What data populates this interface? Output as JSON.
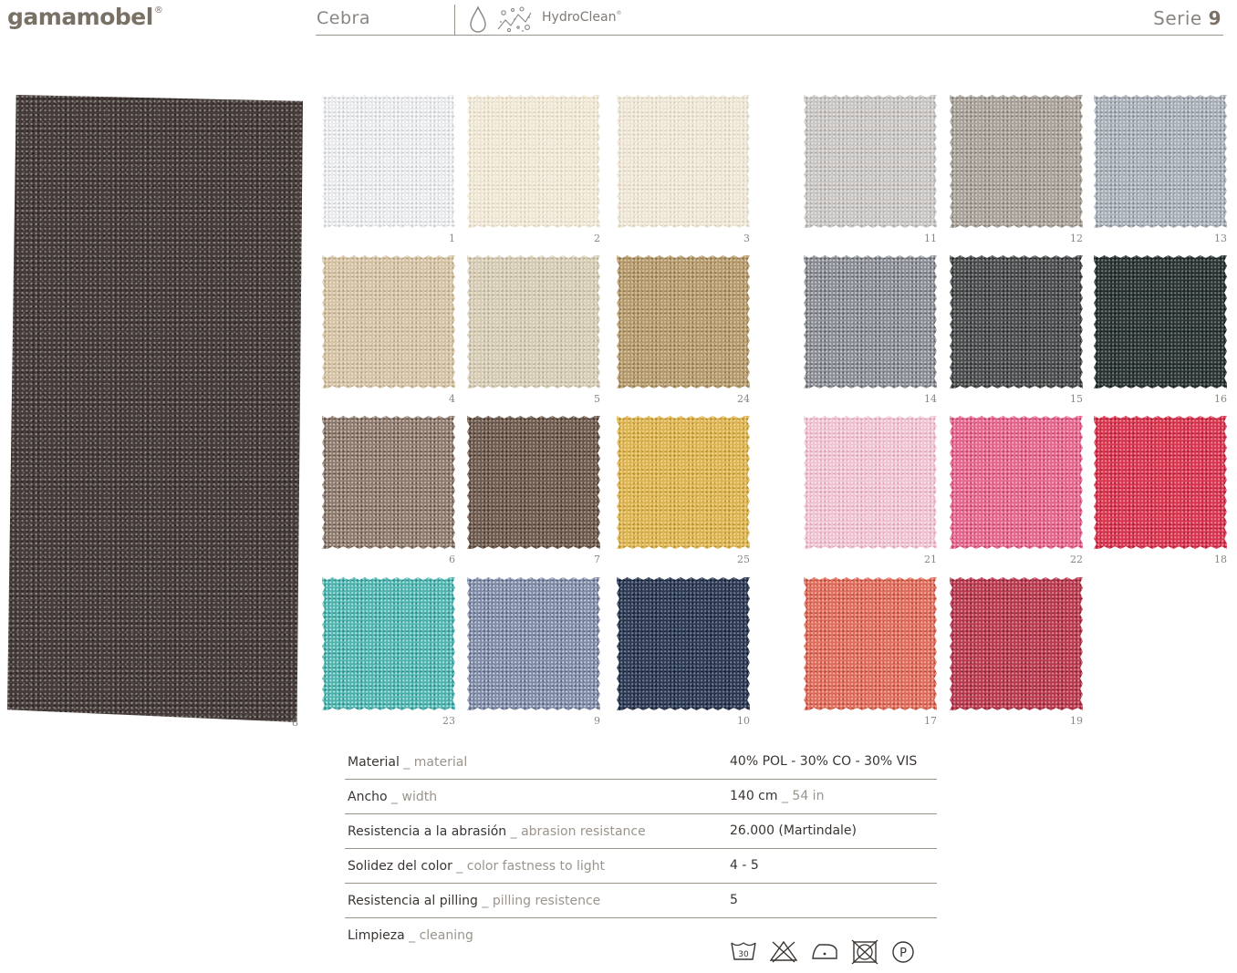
{
  "header": {
    "brand": "gamamobel",
    "brand_mark": "®",
    "fabric_name": "Cebra",
    "treatment_label": "HydroClean",
    "treatment_mark": "®",
    "series_label": "Serie",
    "series_number": "9"
  },
  "big_swatch": {
    "number": "8",
    "color": "#453c3a"
  },
  "swatches": [
    {
      "number": "1",
      "color": "#e9eaec",
      "hi": "#ffffff",
      "lo": "#c9cbd0"
    },
    {
      "number": "2",
      "color": "#efe7d5",
      "hi": "#fbf6ea",
      "lo": "#d8ceb9"
    },
    {
      "number": "3",
      "color": "#ede5d5",
      "hi": "#faf5ea",
      "lo": "#d6ccbb"
    },
    {
      "number": "4",
      "color": "#d5c3a6",
      "hi": "#ecdfc8",
      "lo": "#b3a083"
    },
    {
      "number": "5",
      "color": "#d6ccb6",
      "hi": "#ece5d3",
      "lo": "#b5aa94"
    },
    {
      "number": "24",
      "color": "#b59a6e",
      "hi": "#d9c49c",
      "lo": "#8c7450"
    },
    {
      "number": "6",
      "color": "#8e7a6e",
      "hi": "#c5b8ad",
      "lo": "#5f4e45"
    },
    {
      "number": "7",
      "color": "#6e5b50",
      "hi": "#a6968a",
      "lo": "#47362e"
    },
    {
      "number": "25",
      "color": "#dcb454",
      "hi": "#f1d58b",
      "lo": "#b68e30"
    },
    {
      "number": "23",
      "color": "#4fb4b0",
      "hi": "#a9e2dc",
      "lo": "#2a8b88"
    },
    {
      "number": "9",
      "color": "#7f8ba6",
      "hi": "#c4cad9",
      "lo": "#55617e"
    },
    {
      "number": "10",
      "color": "#2e3a52",
      "hi": "#6f7d97",
      "lo": "#151d2c"
    },
    {
      "number": "11",
      "color": "#c8c5c2",
      "hi": "#e4e2e0",
      "lo": "#a8a4a1"
    },
    {
      "number": "12",
      "color": "#a8a29a",
      "hi": "#cfcac3",
      "lo": "#807a72"
    },
    {
      "number": "13",
      "color": "#aab0b8",
      "hi": "#d4d8dd",
      "lo": "#7f8690"
    },
    {
      "number": "14",
      "color": "#8a8e94",
      "hi": "#c4c7cb",
      "lo": "#5b6066"
    },
    {
      "number": "15",
      "color": "#4a4c4d",
      "hi": "#8d8f90",
      "lo": "#262828"
    },
    {
      "number": "16",
      "color": "#2c3433",
      "hi": "#6e7a78",
      "lo": "#151a1a"
    },
    {
      "number": "21",
      "color": "#efc3d2",
      "hi": "#fbe4ec",
      "lo": "#d99fb3"
    },
    {
      "number": "22",
      "color": "#e5668c",
      "hi": "#f7a9c0",
      "lo": "#c03e66"
    },
    {
      "number": "18",
      "color": "#d8344e",
      "hi": "#f08596",
      "lo": "#a81c33"
    },
    {
      "number": "17",
      "color": "#de6d5c",
      "hi": "#f3aa9c",
      "lo": "#b54739"
    },
    {
      "number": "19",
      "color": "#b83a4f",
      "hi": "#dc8593",
      "lo": "#8a2034"
    }
  ],
  "specs": [
    {
      "label": "Material",
      "label_en": "material",
      "value": "40% POL - 30% CO - 30% VIS"
    },
    {
      "label": "Ancho",
      "label_en": "width",
      "value": "140 cm",
      "value_en": "54 in"
    },
    {
      "label": "Resistencia a la abrasión",
      "label_en": "abrasion resistance",
      "value": "26.000 (Martindale)"
    },
    {
      "label": "Solidez del color",
      "label_en": "color fastness to light",
      "value": "4 - 5"
    },
    {
      "label": "Resistencia al pilling",
      "label_en": "pilling resistence",
      "value": "5"
    },
    {
      "label": "Limpieza",
      "label_en": "cleaning"
    }
  ],
  "separator": "_",
  "care_symbols": {
    "wash_temperature": "30",
    "dry_clean": "P",
    "icons": [
      "wash-30-icon",
      "no-bleach-icon",
      "iron-low-icon",
      "no-tumble-dry-icon",
      "dry-clean-p-icon"
    ]
  }
}
